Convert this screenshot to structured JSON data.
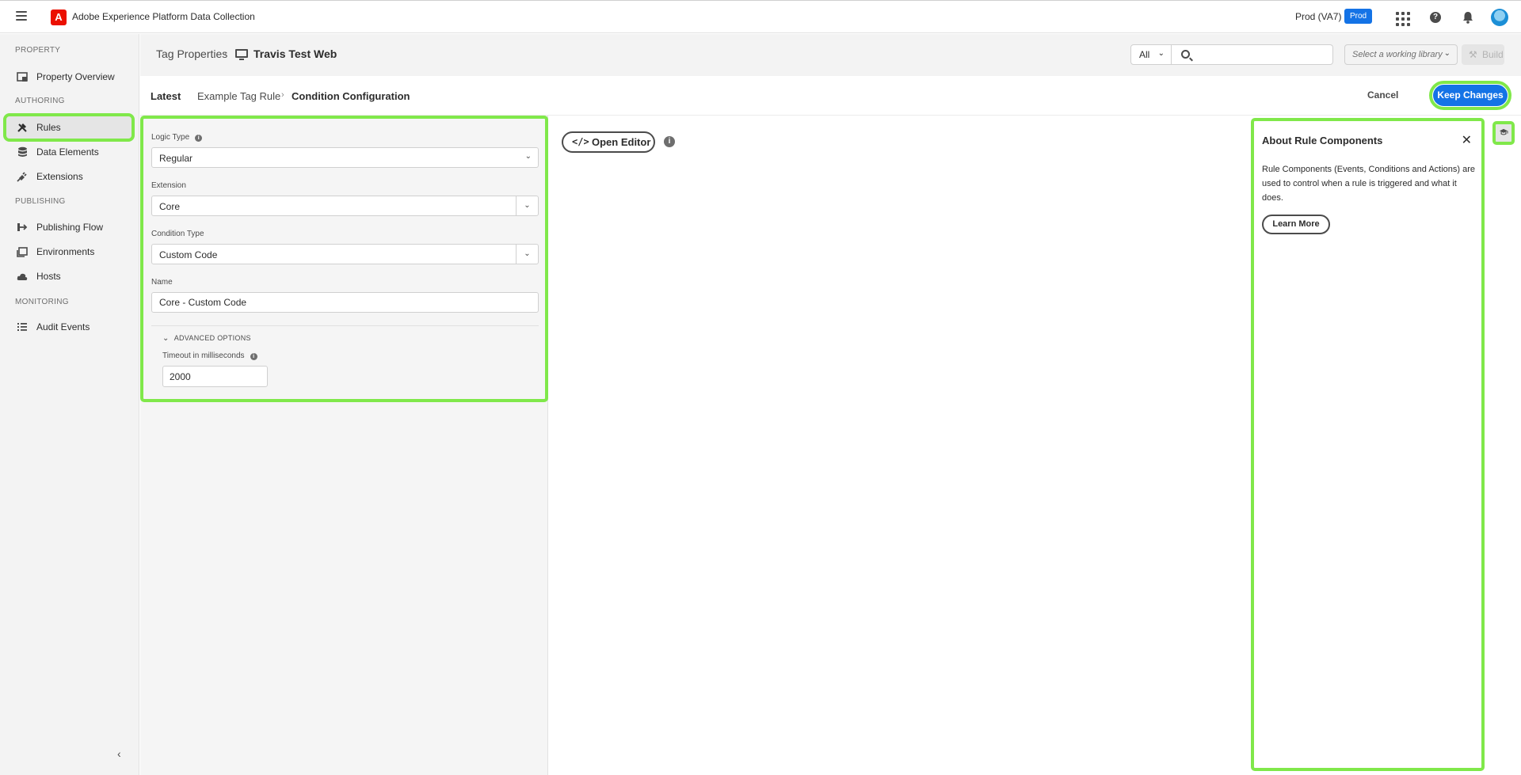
{
  "app": {
    "title": "Adobe Experience Platform Data Collection",
    "logo_letter": "A",
    "org": "Prod (VA7)",
    "env_badge": "Prod"
  },
  "sidebar": {
    "sections": [
      {
        "heading": "PROPERTY",
        "items": [
          {
            "label": "Property Overview",
            "icon": "property-overview-icon"
          }
        ]
      },
      {
        "heading": "AUTHORING",
        "items": [
          {
            "label": "Rules",
            "icon": "rules-icon",
            "selected": true
          },
          {
            "label": "Data Elements",
            "icon": "data-elements-icon"
          },
          {
            "label": "Extensions",
            "icon": "extensions-icon"
          }
        ]
      },
      {
        "heading": "PUBLISHING",
        "items": [
          {
            "label": "Publishing Flow",
            "icon": "publishing-flow-icon"
          },
          {
            "label": "Environments",
            "icon": "environments-icon"
          },
          {
            "label": "Hosts",
            "icon": "hosts-icon"
          }
        ]
      },
      {
        "heading": "MONITORING",
        "items": [
          {
            "label": "Audit Events",
            "icon": "audit-events-icon"
          }
        ]
      }
    ]
  },
  "header": {
    "breadcrumb_root": "Tag Properties",
    "property_name": "Travis Test Web",
    "filter_value": "All",
    "search_placeholder": "",
    "library_placeholder": "Select a working library",
    "build_label": "Build"
  },
  "editor_header": {
    "revision": "Latest",
    "rule_name": "Example Tag Rule",
    "page_title": "Condition Configuration",
    "cancel_label": "Cancel",
    "keep_label": "Keep Changes"
  },
  "form": {
    "logic_type_label": "Logic Type",
    "logic_type_value": "Regular",
    "extension_label": "Extension",
    "extension_value": "Core",
    "condition_type_label": "Condition Type",
    "condition_type_value": "Custom Code",
    "name_label": "Name",
    "name_value": "Core - Custom Code",
    "advanced_label": "ADVANCED OPTIONS",
    "timeout_label": "Timeout in milliseconds",
    "timeout_value": "2000"
  },
  "editor": {
    "open_editor_label": "Open Editor"
  },
  "help": {
    "title": "About Rule Components",
    "body": "Rule Components (Events, Conditions and Actions) are used to control when a rule is triggered and what it does.",
    "learn_more_label": "Learn More"
  },
  "colors": {
    "accent": "#1473e6",
    "highlight": "#80e84a",
    "adobe_red": "#eb1000"
  }
}
